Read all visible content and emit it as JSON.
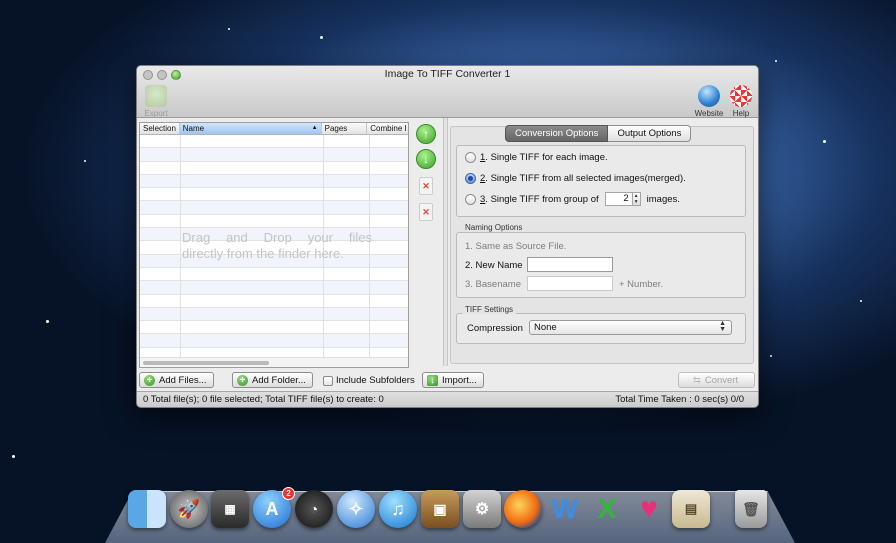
{
  "window": {
    "title": "Image To TIFF Converter 1"
  },
  "toolbar": {
    "export_label": "Export",
    "website_label": "Website",
    "help_label": "Help"
  },
  "table": {
    "columns": [
      "Selection",
      "Name",
      "Pages",
      "Combine I"
    ],
    "sort_indicator": "▲",
    "drop_hint_line1": "Drag and Drop your files",
    "drop_hint_line2": "directly from the finder here."
  },
  "tabs": {
    "active": "Conversion Options",
    "inactive": "Output Options"
  },
  "conversion": {
    "opt1_num": "1",
    "opt1_text": ". Single TIFF for each image.",
    "opt2_num": "2",
    "opt2_text": ". Single TIFF from all selected images(merged).",
    "opt3_num": "3",
    "opt3_text": ". Single TIFF from group of",
    "group_value": "2",
    "opt3_suffix": "images.",
    "selected": 2
  },
  "naming": {
    "legend": "Naming Options",
    "same_as_source": "1. Same as Source File.",
    "new_name_label": "2. New Name",
    "new_name_value": "",
    "basename_label": "3. Basename",
    "basename_value": "",
    "plus_number": "+ Number."
  },
  "tiff_settings": {
    "legend": "TIFF Settings",
    "compression_label": "Compression",
    "compression_value": "None"
  },
  "bottom_bar": {
    "add_files": "Add Files...",
    "add_folder": "Add Folder...",
    "include_subfolders": "Include Subfolders",
    "import": "Import...",
    "convert": "Convert"
  },
  "status": {
    "left": "0 Total file(s); 0 file selected; Total TIFF file(s) to create: 0",
    "right": "Total Time Taken : 0 sec(s) 0/0"
  },
  "dock": {
    "app_store_badge": "2",
    "icons": [
      "finder-icon",
      "launchpad-icon",
      "photo-booth-icon",
      "app-store-icon",
      "dashboard-icon",
      "safari-icon",
      "itunes-icon",
      "iphoto-icon",
      "system-preferences-icon",
      "firefox-icon",
      "word-icon",
      "excel-icon",
      "heart-app-icon",
      "documents-icon",
      "trash-icon"
    ]
  },
  "colors": {
    "accent": "#1e4ba8",
    "disabled_text": "#a6a6a6"
  }
}
